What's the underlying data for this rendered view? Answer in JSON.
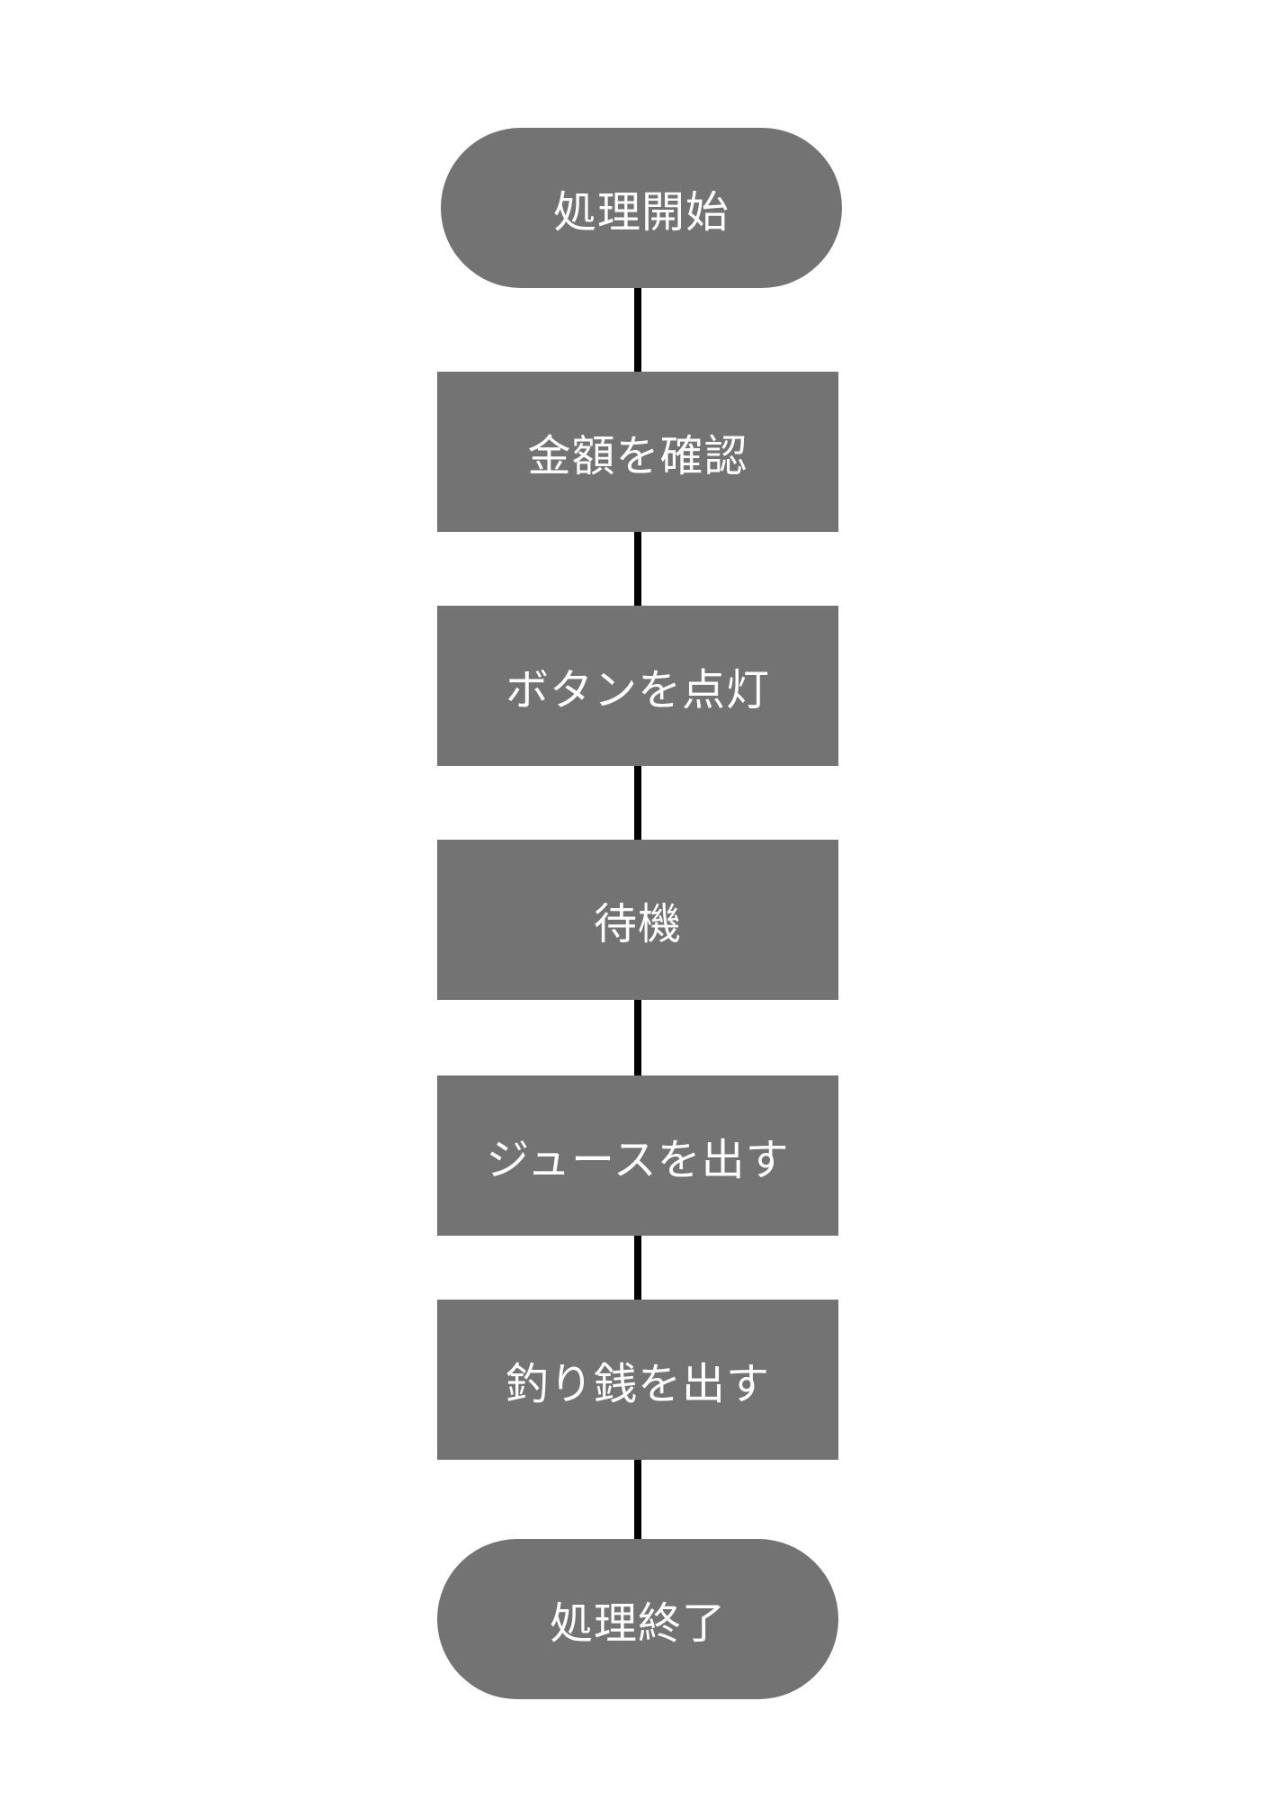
{
  "flowchart": {
    "start": {
      "label": "処理開始"
    },
    "steps": [
      {
        "label": "金額を確認"
      },
      {
        "label": "ボタンを点灯"
      },
      {
        "label": "待機"
      },
      {
        "label": "ジュースを出す"
      },
      {
        "label": "釣り銭を出す"
      }
    ],
    "end": {
      "label": "処理終了"
    }
  },
  "colors": {
    "node_fill": "#737373",
    "node_text": "#ffffff",
    "connector": "#000000",
    "background": "#ffffff"
  }
}
